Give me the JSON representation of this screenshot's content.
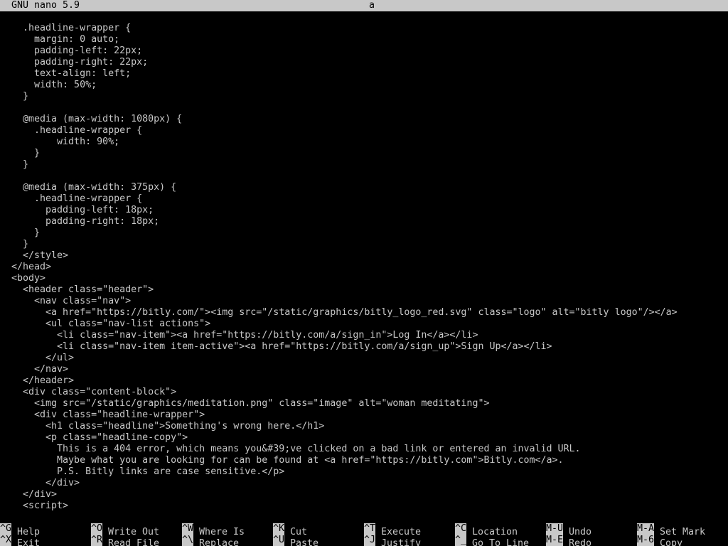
{
  "title_bar": {
    "version": "GNU nano 5.9",
    "filename": "a"
  },
  "editor": {
    "lines": [
      "  .headline-wrapper {",
      "    margin: 0 auto;",
      "    padding-left: 22px;",
      "    padding-right: 22px;",
      "    text-align: left;",
      "    width: 50%;",
      "  }",
      "",
      "  @media (max-width: 1080px) {",
      "    .headline-wrapper {",
      "        width: 90%;",
      "    }",
      "  }",
      "",
      "  @media (max-width: 375px) {",
      "    .headline-wrapper {",
      "      padding-left: 18px;",
      "      padding-right: 18px;",
      "    }",
      "  }",
      "  </style>",
      "</head>",
      "<body>",
      "  <header class=\"header\">",
      "    <nav class=\"nav\">",
      "      <a href=\"https://bitly.com/\"><img src=\"/static/graphics/bitly_logo_red.svg\" class=\"logo\" alt=\"bitly logo\"/></a>",
      "      <ul class=\"nav-list actions\">",
      "        <li class=\"nav-item\"><a href=\"https://bitly.com/a/sign_in\">Log In</a></li>",
      "        <li class=\"nav-item item-active\"><a href=\"https://bitly.com/a/sign_up\">Sign Up</a></li>",
      "      </ul>",
      "    </nav>",
      "  </header>",
      "  <div class=\"content-block\">",
      "    <img src=\"/static/graphics/meditation.png\" class=\"image\" alt=\"woman meditating\">",
      "    <div class=\"headline-wrapper\">",
      "      <h1 class=\"headline\">Something's wrong here.</h1>",
      "      <p class=\"headline-copy\">",
      "        This is a 404 error, which means you&#39;ve clicked on a bad link or entered an invalid URL.",
      "        Maybe what you are looking for can be found at <a href=\"https://bitly.com\">Bitly.com</a>.",
      "        P.S. Bitly links are case sensitive.</p>",
      "      </div>",
      "  </div>",
      "  <script>"
    ]
  },
  "shortcuts": [
    {
      "key": "^G",
      "label": "Help"
    },
    {
      "key": "^X",
      "label": "Exit"
    },
    {
      "key": "^O",
      "label": "Write Out"
    },
    {
      "key": "^R",
      "label": "Read File"
    },
    {
      "key": "^W",
      "label": "Where Is"
    },
    {
      "key": "^\\",
      "label": "Replace"
    },
    {
      "key": "^K",
      "label": "Cut"
    },
    {
      "key": "^U",
      "label": "Paste"
    },
    {
      "key": "^T",
      "label": "Execute"
    },
    {
      "key": "^J",
      "label": "Justify"
    },
    {
      "key": "^C",
      "label": "Location"
    },
    {
      "key": "^_",
      "label": "Go To Line"
    },
    {
      "key": "M-U",
      "label": "Undo"
    },
    {
      "key": "M-E",
      "label": "Redo"
    },
    {
      "key": "M-A",
      "label": "Set Mark"
    },
    {
      "key": "M-6",
      "label": "Copy"
    }
  ]
}
